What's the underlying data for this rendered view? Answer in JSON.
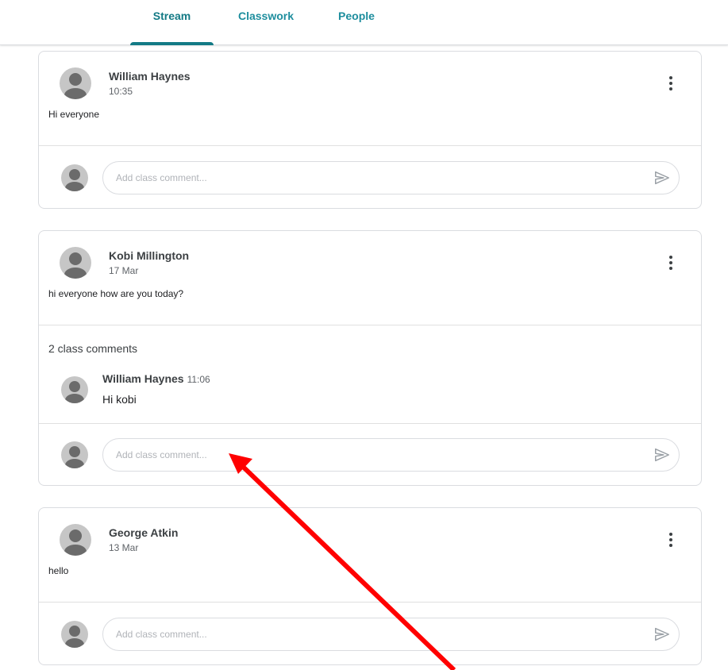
{
  "tabs": [
    {
      "label": "Stream",
      "active": true
    },
    {
      "label": "Classwork",
      "active": false
    },
    {
      "label": "People",
      "active": false
    }
  ],
  "posts": [
    {
      "author": "William Haynes",
      "time": "10:35",
      "text": "Hi everyone",
      "comment_placeholder": "Add class comment..."
    },
    {
      "author": "Kobi Millington",
      "time": "17 Mar",
      "text": "hi everyone how are you today?",
      "comment_count": "2 class comments",
      "comments": [
        {
          "author": "William Haynes",
          "time": "11:06",
          "text": "Hi kobi"
        }
      ],
      "comment_placeholder": "Add class comment..."
    },
    {
      "author": "George Atkin",
      "time": "13 Mar",
      "text": "hello",
      "comment_placeholder": "Add class comment..."
    }
  ],
  "icons": [
    "avatar-icon",
    "more-vert-icon",
    "send-icon"
  ],
  "colors": {
    "accent": "#137a85",
    "tab_text": "#1e8e9e",
    "annotation_arrow": "#ff0000",
    "border": "#dadce0"
  }
}
